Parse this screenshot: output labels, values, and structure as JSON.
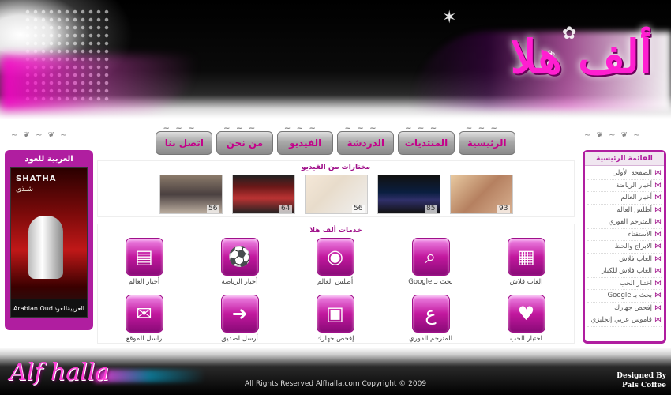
{
  "header": {
    "logo_text": "ألف هلا"
  },
  "nav": {
    "items": [
      "الرئيسية",
      "المنتديات",
      "الدردشة",
      "الفيديو",
      "من نحن",
      "اتصل بنا"
    ]
  },
  "left_panel": {
    "title": "العربية للعود",
    "ad_brand": "SHATHA",
    "ad_brand_ar": "شـذى",
    "ad_footer_en": "Arabian Oud",
    "ad_footer_ar": "العربيةللعود"
  },
  "right_panel": {
    "title": "القائمة الرئيسية",
    "items": [
      "الصفحة الأولى",
      "أخبار الرياضة",
      "أخبار العالم",
      "أطلس العالم",
      "المترجم الفوري",
      "الأستفتاء",
      "الابراج والحظ",
      "العاب فلاش",
      "العاب فلاش للكبار",
      "اختبار الحب",
      "بحث بـ Google",
      "إفحص جهازك",
      "قاموس عربي إنجليزي"
    ]
  },
  "videos": {
    "title": "مختارات من الفيديو",
    "items": [
      {
        "count": "93"
      },
      {
        "count": "85"
      },
      {
        "count": "56"
      },
      {
        "count": "64"
      },
      {
        "count": "56"
      }
    ]
  },
  "services": {
    "title": "خدمات ألف هلا",
    "items": [
      {
        "label": "العاب فلاش",
        "icon": "grid-icon",
        "glyph": "▦"
      },
      {
        "label": "بحث بـ Google",
        "icon": "magnifier-icon",
        "glyph": "⌕"
      },
      {
        "label": "أطلس العالم",
        "icon": "globe-icon",
        "glyph": "◉"
      },
      {
        "label": "أخبار الرياضة",
        "icon": "soccer-ball-icon",
        "glyph": "⚽"
      },
      {
        "label": "أخبار العالم",
        "icon": "newspaper-icon",
        "glyph": "▤"
      },
      {
        "label": "اختبار الحب",
        "icon": "heart-icon",
        "glyph": "♥"
      },
      {
        "label": "المترجم الفوري",
        "icon": "translate-icon",
        "glyph": "ع"
      },
      {
        "label": "إفحص جهازك",
        "icon": "computer-icon",
        "glyph": "▣"
      },
      {
        "label": "أرسل لصديق",
        "icon": "send-friend-icon",
        "glyph": "➜"
      },
      {
        "label": "راسل الموقع",
        "icon": "envelope-icon",
        "glyph": "✉"
      }
    ]
  },
  "footer": {
    "brand": "Alf halla",
    "copyright": "All Rights Reserved Alfhalla.com Copyright © 2009",
    "designed_by": "Designed By",
    "designer": "Pals Coffee"
  }
}
